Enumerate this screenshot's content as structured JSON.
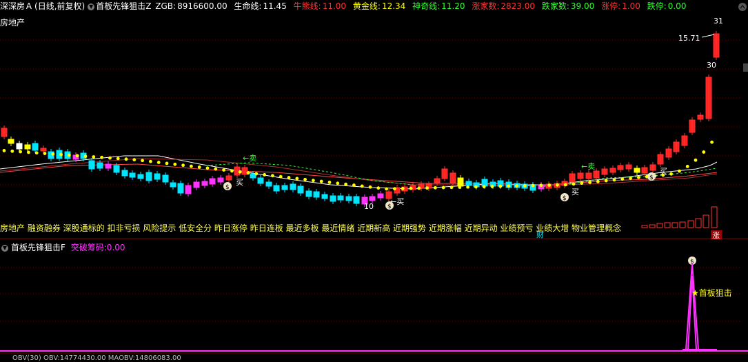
{
  "header": {
    "symbol": "深深房Ａ",
    "period": "(日线,前复权)",
    "indicator_name": "首板先锋狙击Z",
    "zgb_label": "ZGB:",
    "zgb_value": "8916600.00",
    "lifeline_label": "生命线:",
    "lifeline_value": "11.45",
    "bullbear_label": "牛熊线:",
    "bullbear_value": "11.00",
    "golden_label": "黄金线:",
    "golden_value": "12.34",
    "magic_label": "神奇线:",
    "magic_value": "11.20",
    "up_count_label": "涨家数:",
    "up_count_value": "2823.00",
    "down_count_label": "跌家数:",
    "down_count_value": "39.00",
    "limit_up_label": "涨停:",
    "limit_up_value": "1.00",
    "limit_down_label": "跌停:",
    "limit_down_value": "0.00"
  },
  "sector_label": "房地产",
  "main_chart": {
    "max_label": "15.71",
    "right_top_label": "31",
    "right_mid_label": "30",
    "low_label": "10",
    "sell_label": "←卖",
    "buy_label": "买",
    "buy_label2": "←买",
    "cai_label": "财",
    "zhang_label": "涨"
  },
  "concepts_text": "房地产 融资融券 深股通标的 扣非亏损 风险提示 低安全分 昨日涨停 昨日连板 最近多板 最近情绪 近期新高 近期强势 近期涨幅 近期异动 业绩预亏 业绩大增 物业管理概念",
  "sub_header": {
    "indicator_name": "首板先锋狙击F",
    "breakout_label": "突破筹码:",
    "breakout_value": "0.00",
    "signal_label": "★首板狙击"
  },
  "bottom_line": "OBV(30) OBV:14774430.00  MAOBV:14806083.00",
  "colors": {
    "up": "#ff3333",
    "down": "#00e5ff",
    "yellow": "#ffff00",
    "magenta": "#ff33ff",
    "white": "#ffffff",
    "green": "#33ff33"
  }
}
